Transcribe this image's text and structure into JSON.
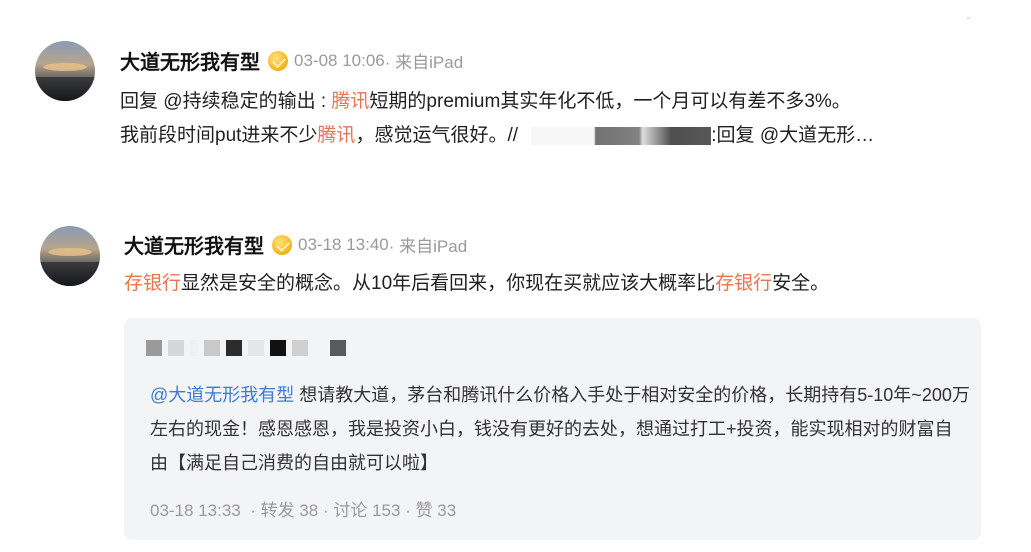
{
  "corner_mark": "’’",
  "posts": [
    {
      "author": "大道无形我有型",
      "time": "03-08 10:06",
      "source": "· 来自iPad",
      "line1": {
        "prefix": "回复 @持续稳定的输出 : ",
        "hl1": "腾讯",
        "rest": "短期的premium其实年化不低，一个月可以有差不多3%。"
      },
      "line2": {
        "a": "我前段时间put进来不少",
        "hl": "腾讯",
        "b": "，感觉运气很好。//",
        "c": ":回复 @大道无形…"
      }
    },
    {
      "author": "大道无形我有型",
      "time": "03-18 13:40",
      "source": "· 来自iPad",
      "line": {
        "hl1": "存银行",
        "mid": "显然是安全的概念。从10年后看回来，你现在买就应该大概率比",
        "hl2": "存银行",
        "end": "安全。"
      },
      "quote": {
        "mention": "@大道无形我有型",
        "text": " 想请教大道，茅台和腾讯什么价格入手处于相对安全的价格，长期持有5-10年~200万左右的现金！感恩感恩，我是投资小白，钱没有更好的去处，想通过打工+投资，能实现相对的财富自由【满足自己消费的自由就可以啦】",
        "time": "03-18 13:33",
        "repost": "· 转发 38",
        "comment": "· 讨论 153",
        "like": "· 赞 33"
      }
    }
  ],
  "colors": {
    "highlight": "#eb7350",
    "link": "#3a7bd5",
    "meta": "#9a9a9a"
  }
}
